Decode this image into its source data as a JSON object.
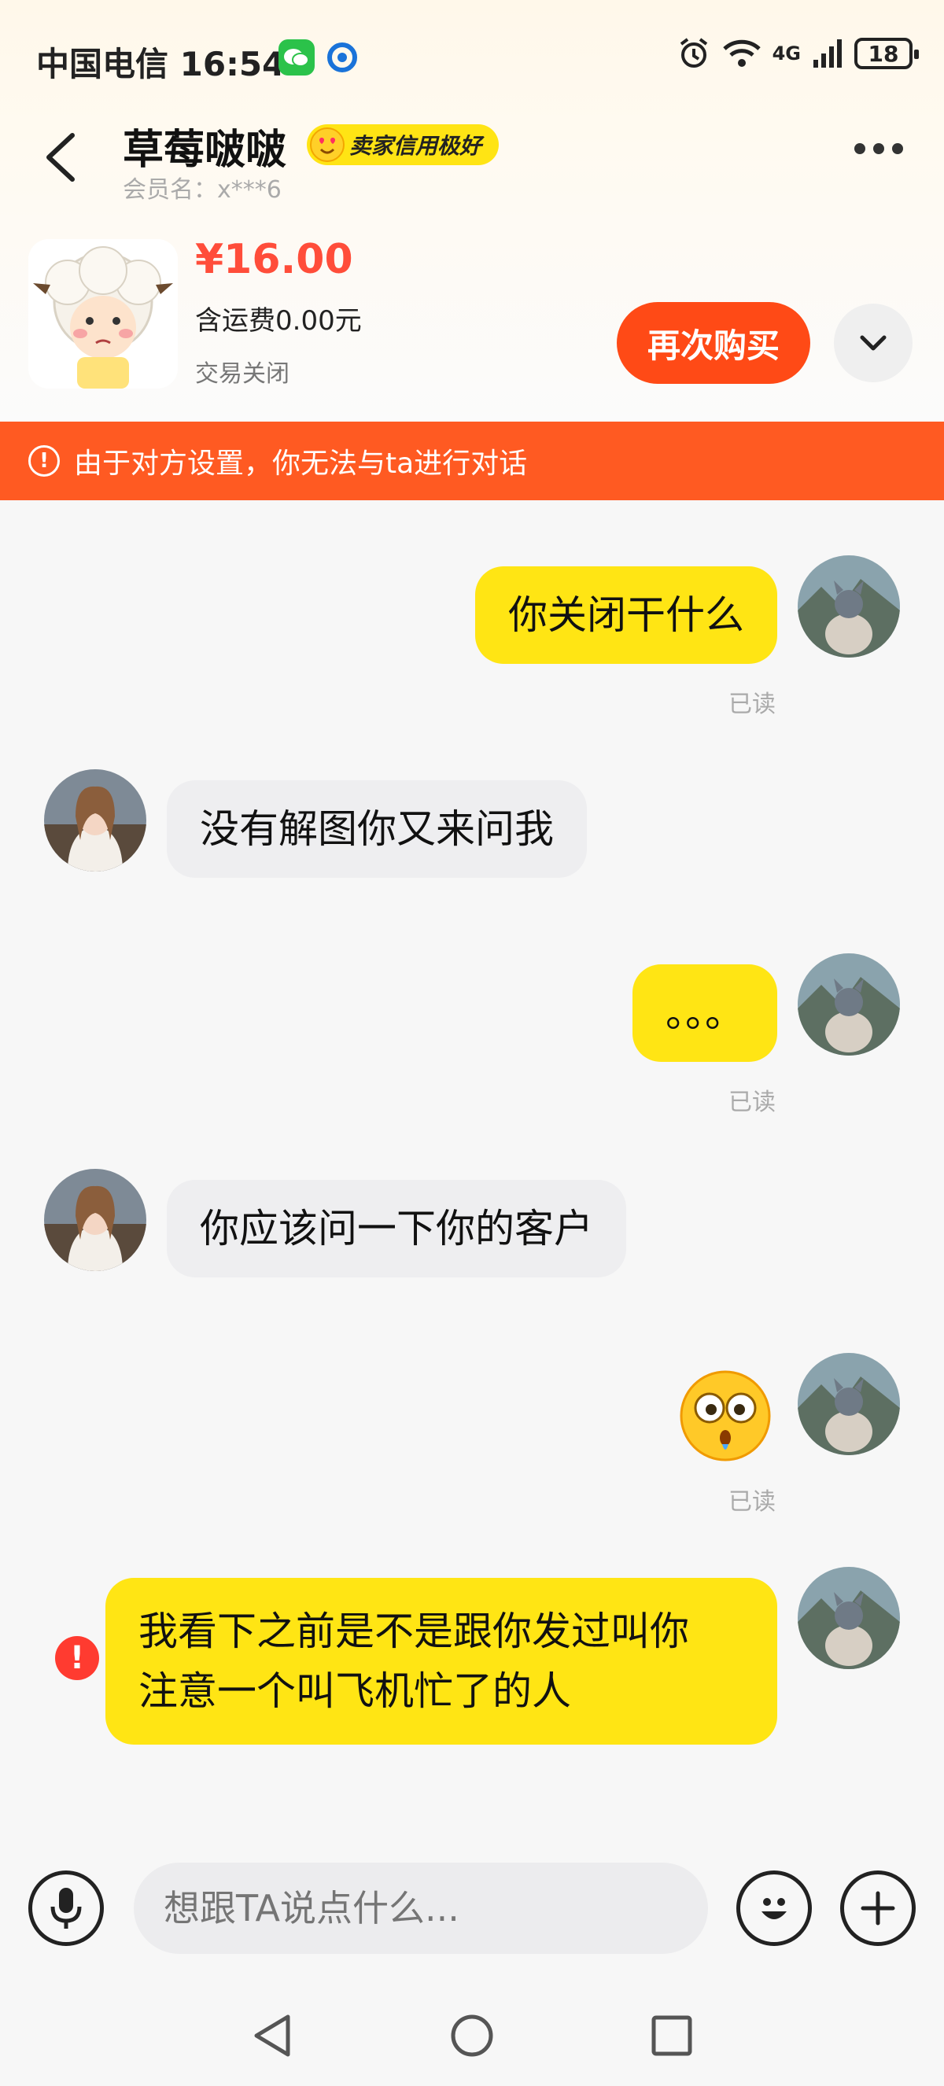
{
  "status_bar": {
    "carrier": "中国电信",
    "time": "16:54",
    "network": "4G",
    "battery": "18"
  },
  "header": {
    "seller_name": "草莓啵啵",
    "credit_badge": "卖家信用极好",
    "member_label": "会员名：x***6"
  },
  "product": {
    "price": "¥16.00",
    "shipping": "含运费0.00元",
    "status": "交易关闭",
    "rebuy_label": "再次购买"
  },
  "banner": {
    "text": "由于对方设置，你无法与ta进行对话"
  },
  "messages": [
    {
      "side": "me",
      "text": "你关闭干什么",
      "read": "已读"
    },
    {
      "side": "them",
      "text": "没有解图你又来问我"
    },
    {
      "side": "me",
      "text": "。。。",
      "read": "已读"
    },
    {
      "side": "them",
      "text": "你应该问一下你的客户"
    },
    {
      "side": "me",
      "sticker": "crying-face-sticker",
      "read": "已读"
    },
    {
      "side": "me",
      "line1": "我看下之前是不是跟你发过叫你",
      "line2": "注意一个叫飞机忙了的人",
      "failed": true
    }
  ],
  "input": {
    "placeholder": "想跟TA说点什么..."
  },
  "colors": {
    "accent": "#ff4a16",
    "bubble_me": "#ffe514",
    "bubble_them": "#eeeef0",
    "price": "#ff4d3a"
  }
}
